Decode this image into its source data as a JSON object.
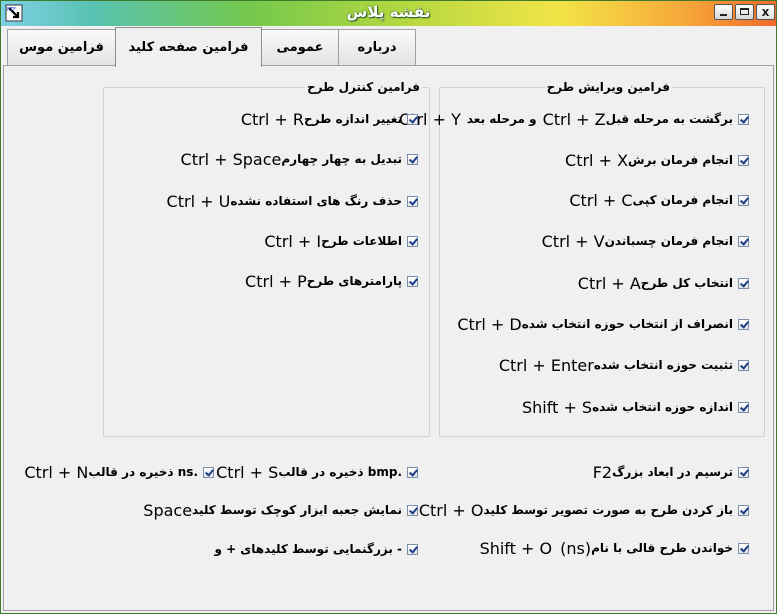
{
  "window": {
    "title": "نقشه پلاس"
  },
  "tabs": [
    {
      "label": "فرامین موس",
      "active": false
    },
    {
      "label": "فرامین صفحه کلید",
      "active": true
    },
    {
      "label": "عمومی",
      "active": false
    },
    {
      "label": "درباره",
      "active": false
    }
  ],
  "edit_group": {
    "title": "فرامین ویرایش طرح",
    "items": [
      {
        "label": "برگشت به مرحله قبل",
        "key": "Ctrl + Z",
        "label2": "و مرحله بعد",
        "key2": "Ctrl + Y",
        "checked": true
      },
      {
        "label": "انجام فرمان برش",
        "key": "Ctrl + X",
        "checked": true
      },
      {
        "label": "انجام فرمان کپی",
        "key": "Ctrl + C",
        "checked": true
      },
      {
        "label": "انجام فرمان چسباندن",
        "key": "Ctrl + V",
        "checked": true
      },
      {
        "label": "انتخاب کل طرح",
        "key": "Ctrl + A",
        "checked": true
      },
      {
        "label": "انصراف از انتخاب حوزه انتخاب شده",
        "key": "Ctrl + D",
        "checked": true
      },
      {
        "label": "تثبیت حوزه انتخاب شده",
        "key": "Ctrl + Enter",
        "checked": true
      },
      {
        "label": "اندازه حوزه انتخاب شده",
        "key": "Shift + S",
        "checked": true
      }
    ]
  },
  "control_group": {
    "title": "فرامین کنترل طرح",
    "items": [
      {
        "label": "تغییر اندازه طرح",
        "key": "Ctrl + R",
        "checked": true
      },
      {
        "label": "تبدیل به چهار چهارم",
        "key": "Ctrl + Space",
        "checked": true
      },
      {
        "label": "حذف رنگ های استفاده نشده",
        "key": "Ctrl + U",
        "checked": true
      },
      {
        "label": "اطلاعات طرح",
        "key": "Ctrl + I",
        "checked": true
      },
      {
        "label": "پارامترهای طرح",
        "key": "Ctrl + P",
        "checked": true
      }
    ]
  },
  "bottom": {
    "draw_big": {
      "label": "ترسیم در ابعاد بزرگ",
      "key": "F2",
      "checked": true
    },
    "save_bmp": {
      "label": "ذخیره در قالب bmp.",
      "key": "Ctrl + S",
      "checked": true
    },
    "save_ns": {
      "label": "ذخیره در قالب ns.",
      "key": "Ctrl + N",
      "checked": true
    },
    "open_image": {
      "label": "باز کردن طرح به صورت تصویر توسط کلید",
      "key": "Ctrl + O",
      "checked": true
    },
    "toolbox": {
      "label": "نمایش جعبه ابزار کوچک توسط کلید",
      "key": "Space",
      "checked": true
    },
    "read_ns": {
      "label": "خواندن طرح قالی با نام",
      "ext": "(ns)",
      "key": "Shift + O",
      "checked": true
    },
    "zoom": {
      "label": "بزرگنمایی توسط کلیدهای + و -",
      "checked": true
    }
  },
  "colors": {
    "titlebar_start": "#7fd1e6",
    "titlebar_end": "#ef6a2c",
    "panel": "#f0f0f0"
  }
}
